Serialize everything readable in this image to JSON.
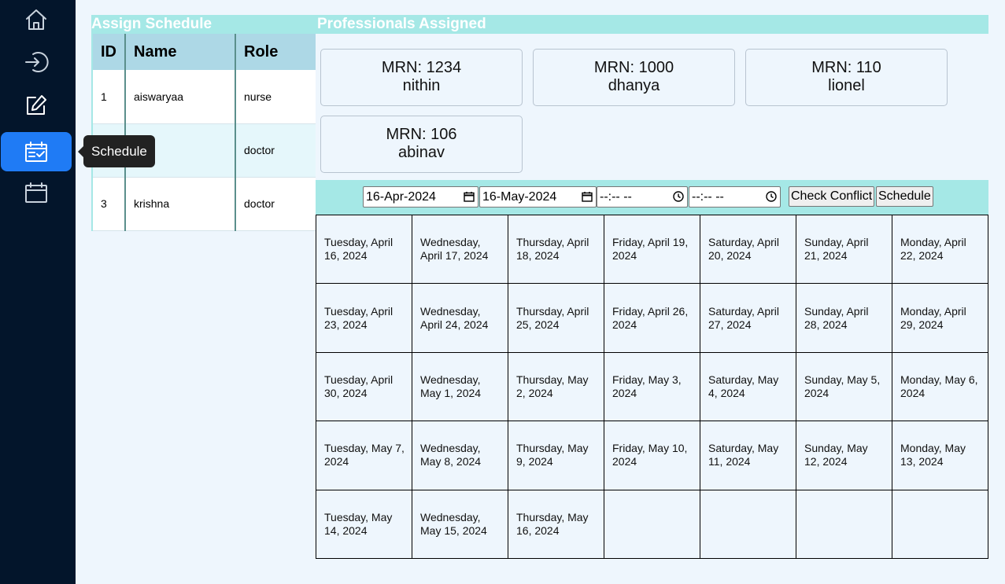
{
  "sidebar": {
    "items": [
      {
        "icon": "home-icon"
      },
      {
        "icon": "login-icon"
      },
      {
        "icon": "edit-icon"
      },
      {
        "icon": "schedule-check-icon",
        "active": true
      },
      {
        "icon": "calendar-icon"
      }
    ],
    "tooltip": "Schedule"
  },
  "assign": {
    "title": "Assign Schedule",
    "columns": [
      "ID",
      "Name",
      "Role"
    ],
    "rows": [
      {
        "id": "1",
        "name": "aiswaryaa",
        "role": "nurse"
      },
      {
        "id": "",
        "name": "",
        "role": "doctor"
      },
      {
        "id": "3",
        "name": "krishna",
        "role": "doctor"
      }
    ]
  },
  "assigned": {
    "title": "Professionals Assigned",
    "cards": [
      {
        "mrn": "MRN: 1234",
        "name": "nithin"
      },
      {
        "mrn": "MRN: 1000",
        "name": "dhanya"
      },
      {
        "mrn": "MRN: 110",
        "name": "lionel"
      },
      {
        "mrn": "MRN: 106",
        "name": "abinav"
      }
    ]
  },
  "controls": {
    "start_date": "16-Apr-2024",
    "end_date": "16-May-2024",
    "start_time": "--:-- --",
    "end_time": "--:-- --",
    "check_label": "Check Conflict",
    "schedule_label": "Schedule"
  },
  "calendar": {
    "days": [
      "Tuesday, April 16, 2024",
      "Wednesday, April 17, 2024",
      "Thursday, April 18, 2024",
      "Friday, April 19, 2024",
      "Saturday, April 20, 2024",
      "Sunday, April 21, 2024",
      "Monday, April 22, 2024",
      "Tuesday, April 23, 2024",
      "Wednesday, April 24, 2024",
      "Thursday, April 25, 2024",
      "Friday, April 26, 2024",
      "Saturday, April 27, 2024",
      "Sunday, April 28, 2024",
      "Monday, April 29, 2024",
      "Tuesday, April 30, 2024",
      "Wednesday, May 1, 2024",
      "Thursday, May 2, 2024",
      "Friday, May 3, 2024",
      "Saturday, May 4, 2024",
      "Sunday, May 5, 2024",
      "Monday, May 6, 2024",
      "Tuesday, May 7, 2024",
      "Wednesday, May 8, 2024",
      "Thursday, May 9, 2024",
      "Friday, May 10, 2024",
      "Saturday, May 11, 2024",
      "Sunday, May 12, 2024",
      "Monday, May 13, 2024",
      "Tuesday, May 14, 2024",
      "Wednesday, May 15, 2024",
      "Thursday, May 16, 2024",
      "",
      "",
      "",
      ""
    ]
  },
  "colors": {
    "sidebar": "#03152b",
    "active": "#1f7bf5",
    "accent": "#a5e8e6",
    "table_header": "#add8e6"
  }
}
